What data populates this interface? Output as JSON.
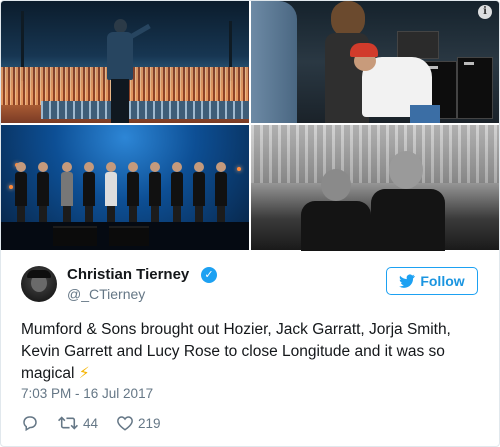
{
  "tweet": {
    "author_name": "Christian Tierney",
    "handle": "@_CTierney",
    "follow_label": "Follow",
    "text": "Mumford & Sons brought out Hozier, Jack Garratt, Jorja Smith, Kevin Garrett and Lucy Rose to close Longitude and it was so magical",
    "emoji": "⚡",
    "timestamp": "7:03 PM - 16 Jul 2017",
    "retweets": "44",
    "likes": "219"
  },
  "icons": {
    "verified": "verified-badge-icon",
    "bird": "twitter-bird-icon",
    "info": "info-icon",
    "reply": "reply-icon",
    "retweet": "retweet-icon",
    "like": "heart-icon"
  },
  "colors": {
    "accent": "#1da1f2",
    "text": "#14171a",
    "muted": "#657786"
  }
}
